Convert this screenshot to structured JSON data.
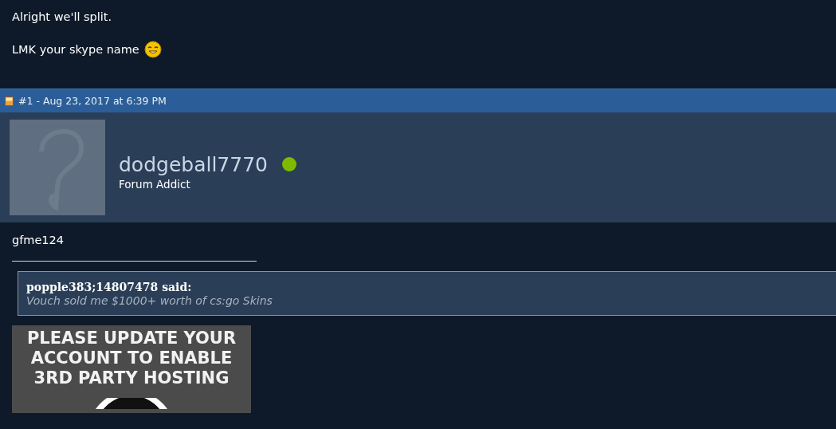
{
  "previous_post": {
    "lines": [
      {
        "text": "Alright we'll split.",
        "emoticon": false
      },
      {
        "text": "LMK your skype name",
        "emoticon": true
      }
    ]
  },
  "post": {
    "header": "#1 - Aug 23, 2017 at 6:39 PM",
    "author": {
      "username": "dodgeball7770",
      "online": true,
      "rank": "Forum Addict"
    },
    "message": "gfme124",
    "signature": {
      "quote": {
        "author": "popple383;14807478 said:",
        "text": "Vouch sold me $1000+ worth of cs:go Skins"
      },
      "banner_lines": [
        "PLEASE UPDATE YOUR",
        "ACCOUNT TO ENABLE",
        "3RD PARTY HOSTING"
      ]
    }
  }
}
